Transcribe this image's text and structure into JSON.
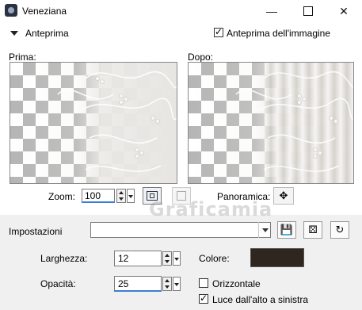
{
  "window": {
    "title": "Veneziana",
    "minimize_glyph": "—",
    "close_glyph": "✕"
  },
  "preview": {
    "section_label": "Anteprima",
    "show_preview_label": "Anteprima dell'immagine",
    "show_preview_checked": true,
    "before_label": "Prima:",
    "after_label": "Dopo:"
  },
  "zoom": {
    "label": "Zoom:",
    "value": "100",
    "pan_label": "Panoramica:",
    "pan_glyph": "✥"
  },
  "settings": {
    "label": "Impostazioni",
    "preset_value": "",
    "save_glyph": "💾",
    "random_glyph": "⚄",
    "reset_glyph": "↻"
  },
  "params": {
    "width_label": "Larghezza:",
    "width_value": "12",
    "color_label": "Colore:",
    "color_value": "#2e261f",
    "opacity_label": "Opacità:",
    "opacity_value": "25",
    "horizontal_label": "Orizzontale",
    "horizontal_checked": false,
    "light_label": "Luce dall'alto a sinistra",
    "light_checked": true
  },
  "watermark": "Graficamia"
}
